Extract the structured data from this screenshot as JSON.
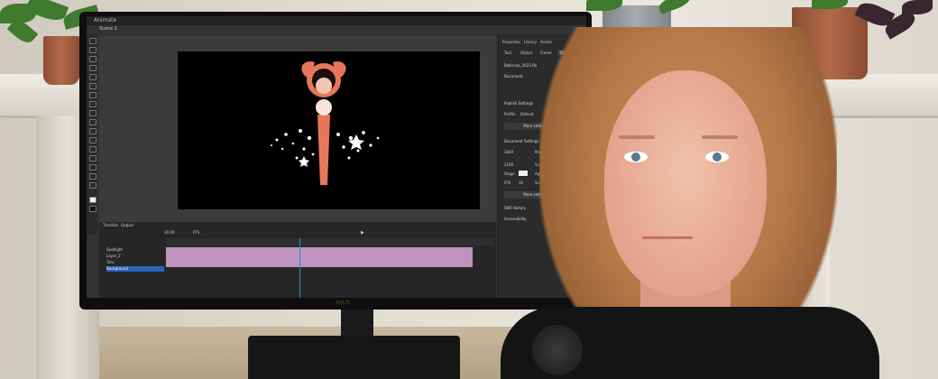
{
  "app": {
    "window_title": "Animate",
    "scene_label": "Scene 1",
    "properties_tabs": [
      "Properties",
      "Library",
      "Assets"
    ],
    "sub_tabs": [
      "Tool",
      "Object",
      "Frame",
      "Doc"
    ],
    "document_name": "Ballerina_2023.fla",
    "document_label": "Document",
    "publish_settings": "Publish Settings",
    "profile_label": "Profile",
    "profile_value": "Default",
    "more_settings_1": "More settings",
    "document_settings": "Document Settings",
    "width_value": "3840",
    "height_value": "2160",
    "match_contents": "Match contents",
    "scale_content": "Scale Content",
    "apply_pasteboard": "Apply to pasteboard",
    "stage_label": "Stage",
    "fps_label": "FPS",
    "fps_field": "30",
    "scale_spans": "Scale Spans",
    "more_settings_2": "More settings",
    "swf_history": "SWF History",
    "accessibility": "Accessibility",
    "timeline_tab": "Timeline",
    "output_tab": "Output",
    "fps_display": "30.00",
    "fps_unit": "FPS",
    "layers": [
      "Spotlight",
      "Layer_2",
      "Tutu",
      "Background"
    ],
    "monitor_brand": "ASUS"
  },
  "colors": {
    "stage": "#000000",
    "ballerina": "#e8775a",
    "playhead": "#1d8fe0",
    "frames": "#d9a7d8",
    "selected_layer": "#2a63b8"
  }
}
